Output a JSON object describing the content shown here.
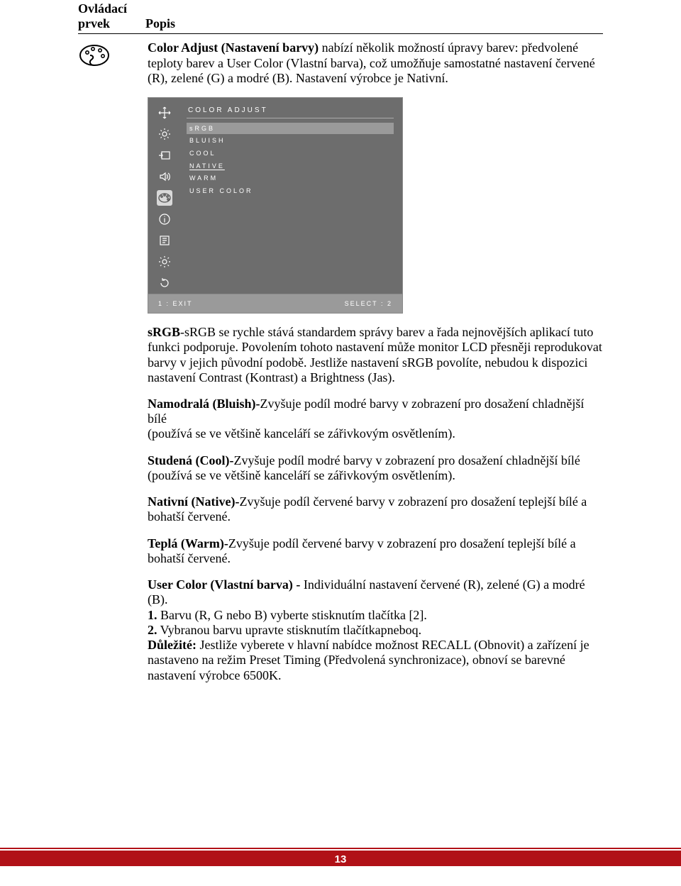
{
  "header": {
    "col1_line1": "Ovládací",
    "col1_line2": "prvek",
    "col2": "Popis"
  },
  "intro": {
    "b1": "Color Adjust (Nastavení barvy)",
    "t1": " nabízí několik možností úpravy barev: předvolené teploty barev a User Color (Vlastní barva), což umožňuje samostatné nastavení červené (R), zelené (G) a modré (B). Nastavení výrobce je Nativní."
  },
  "osd": {
    "title": "COLOR ADJUST",
    "items": [
      "sRGB",
      "BLUISH",
      "COOL",
      "NATIVE",
      "WARM",
      "USER COLOR"
    ],
    "footer_left": "1 : EXIT",
    "footer_right": "SELECT : 2"
  },
  "srgb": {
    "b": "sRGB",
    "t": "-sRGB se rychle stává standardem správy barev a řada nejnovějších aplikací tuto funkci podporuje. Povolením tohoto nastavení může monitor LCD přesněji reprodukovat barvy v jejich původní podobě. Jestliže nastavení sRGB povolíte, nebudou k dispozici nastavení Contrast (Kontrast) a Brightness (Jas)."
  },
  "bluish": {
    "b": "Namodralá (Bluish)-",
    "t1": "Zvyšuje podíl modré barvy v zobrazení pro dosažení chladnější bílé",
    "t2": "(používá se ve většině kanceláří se zářivkovým osvětlením)."
  },
  "cool": {
    "b": "Studená (Cool)-",
    "t1": "Zvyšuje podíl modré barvy v zobrazení pro dosažení chladnější bílé",
    "t2": "(používá se ve většině kanceláří se zářivkovým osvětlením)."
  },
  "native": {
    "b": "Nativní (Native)-",
    "t": "Zvyšuje podíl červené barvy v zobrazení pro dosažení teplejší bílé a bohatší červené."
  },
  "warm": {
    "b": "Teplá (Warm)-",
    "t": "Zvyšuje podíl červené barvy v zobrazení pro dosažení teplejší bílé a bohatší červené."
  },
  "user": {
    "b": "User Color (Vlastní barva) - ",
    "t": "Individuální nastavení červené (R), zelené (G) a modré (B).",
    "n1b": "1.",
    "n1": " Barvu (R, G nebo B) vyberte stisknutím tlačítka [2].",
    "n2b": "2.",
    "n2": " Vybranou barvu upravte stisknutím tlačítkapneboq.",
    "impb": "Důležité:",
    "imp": " Jestliže vyberete v hlavní nabídce možnost RECALL (Obnovit) a zařízení je nastaveno na režim Preset Timing (Předvolená synchronizace), obnoví se barevné nastavení výrobce 6500K."
  },
  "page_number": "13"
}
